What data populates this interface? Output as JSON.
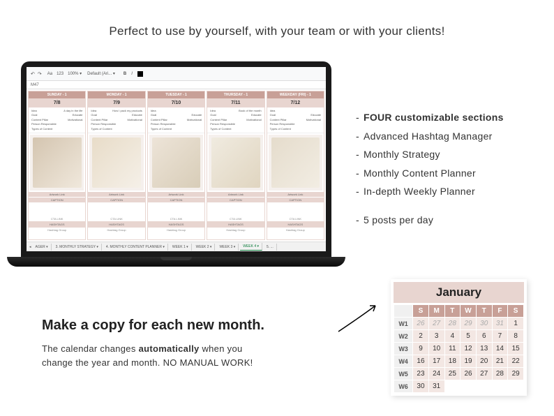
{
  "headline": "Perfect to use by yourself, with your team or with your clients!",
  "toolbar": {
    "undo": "↶",
    "redo": "↷",
    "font": "Aa",
    "size": "123",
    "zoom": "100% ▾",
    "select": "Default (Ari... ▾",
    "bold": "B",
    "italic": "I"
  },
  "cellref": "M47",
  "days": [
    {
      "name": "SUNDAY - 1",
      "date": "7/8"
    },
    {
      "name": "MONDAY - 1",
      "date": "7/9"
    },
    {
      "name": "TUESDAY - 1",
      "date": "7/10"
    },
    {
      "name": "THURSDAY - 1",
      "date": "7/11"
    },
    {
      "name": "WEEKDAY (FRI) - 1",
      "date": "7/12"
    }
  ],
  "fieldLabels": {
    "idea": "Idea",
    "goal": "Goal",
    "contentPillar": "Content Pillar",
    "personResp": "Person Responsible",
    "typeContent": "Types of Content"
  },
  "fieldValues": [
    {
      "idea": "A day in the life",
      "goal": "Educate",
      "cp": "Motivational",
      "pr": "",
      "tc": ""
    },
    {
      "idea": "How I pack my products",
      "goal": "Educate",
      "cp": "Motivational",
      "pr": "",
      "tc": ""
    },
    {
      "idea": "",
      "goal": "Educate",
      "cp": "Motivational",
      "pr": "",
      "tc": ""
    },
    {
      "idea": "Book of the month",
      "goal": "Educate",
      "cp": "Motivational",
      "pr": "",
      "tc": ""
    },
    {
      "idea": "",
      "goal": "Educate",
      "cp": "Motivational",
      "pr": "",
      "tc": ""
    }
  ],
  "labels": {
    "artwork": "Artwork Link",
    "caption": "CAPTION",
    "cta": "CTA LINK",
    "hashtags": "HASHTAGS",
    "hashgroup": "Hashtag Group"
  },
  "tabs": {
    "items": [
      "AGER ▾",
      "3. MONTHLY STRATEGY ▾",
      "4. MONTHLY CONTENT PLANNER ▾",
      "WEEK 1 ▾",
      "WEEK 2 ▾",
      "WEEK 3 ▾",
      "WEEK 4 ▾",
      "5. ..."
    ],
    "activeIdx": 6
  },
  "features": [
    {
      "text": "FOUR customizable sections",
      "bold": true
    },
    {
      "text": "Advanced Hashtag Manager",
      "bold": false
    },
    {
      "text": "Monthly Strategy",
      "bold": false
    },
    {
      "text": "Monthly Content Planner",
      "bold": false
    },
    {
      "text": "In-depth Weekly Planner",
      "bold": false
    }
  ],
  "postsPerDay": "5 posts per day",
  "bottom": {
    "title": "Make a copy for each new month.",
    "line1a": "The calendar changes ",
    "line1b": "automatically",
    "line1c": " when you",
    "line2": "change the year and month. NO MANUAL WORK!"
  },
  "calendar": {
    "month": "January",
    "dow": [
      "S",
      "M",
      "T",
      "W",
      "T",
      "F",
      "S"
    ],
    "weeks": [
      {
        "wk": "W1",
        "days": [
          {
            "d": "26",
            "p": true
          },
          {
            "d": "27",
            "p": true
          },
          {
            "d": "28",
            "p": true
          },
          {
            "d": "29",
            "p": true
          },
          {
            "d": "30",
            "p": true
          },
          {
            "d": "31",
            "p": true
          },
          {
            "d": "1"
          }
        ]
      },
      {
        "wk": "W2",
        "days": [
          {
            "d": "2"
          },
          {
            "d": "3"
          },
          {
            "d": "4"
          },
          {
            "d": "5"
          },
          {
            "d": "6"
          },
          {
            "d": "7"
          },
          {
            "d": "8"
          }
        ]
      },
      {
        "wk": "W3",
        "days": [
          {
            "d": "9"
          },
          {
            "d": "10"
          },
          {
            "d": "11"
          },
          {
            "d": "12"
          },
          {
            "d": "13"
          },
          {
            "d": "14"
          },
          {
            "d": "15"
          }
        ]
      },
      {
        "wk": "W4",
        "days": [
          {
            "d": "16"
          },
          {
            "d": "17"
          },
          {
            "d": "18"
          },
          {
            "d": "19"
          },
          {
            "d": "20"
          },
          {
            "d": "21"
          },
          {
            "d": "22"
          }
        ]
      },
      {
        "wk": "W5",
        "days": [
          {
            "d": "23"
          },
          {
            "d": "24"
          },
          {
            "d": "25"
          },
          {
            "d": "26"
          },
          {
            "d": "27"
          },
          {
            "d": "28"
          },
          {
            "d": "29"
          }
        ]
      },
      {
        "wk": "W6",
        "days": [
          {
            "d": "30"
          },
          {
            "d": "31"
          },
          {
            "d": "",
            "e": true
          },
          {
            "d": "",
            "e": true
          },
          {
            "d": "",
            "e": true
          },
          {
            "d": "",
            "e": true
          },
          {
            "d": "",
            "e": true
          }
        ]
      }
    ]
  }
}
